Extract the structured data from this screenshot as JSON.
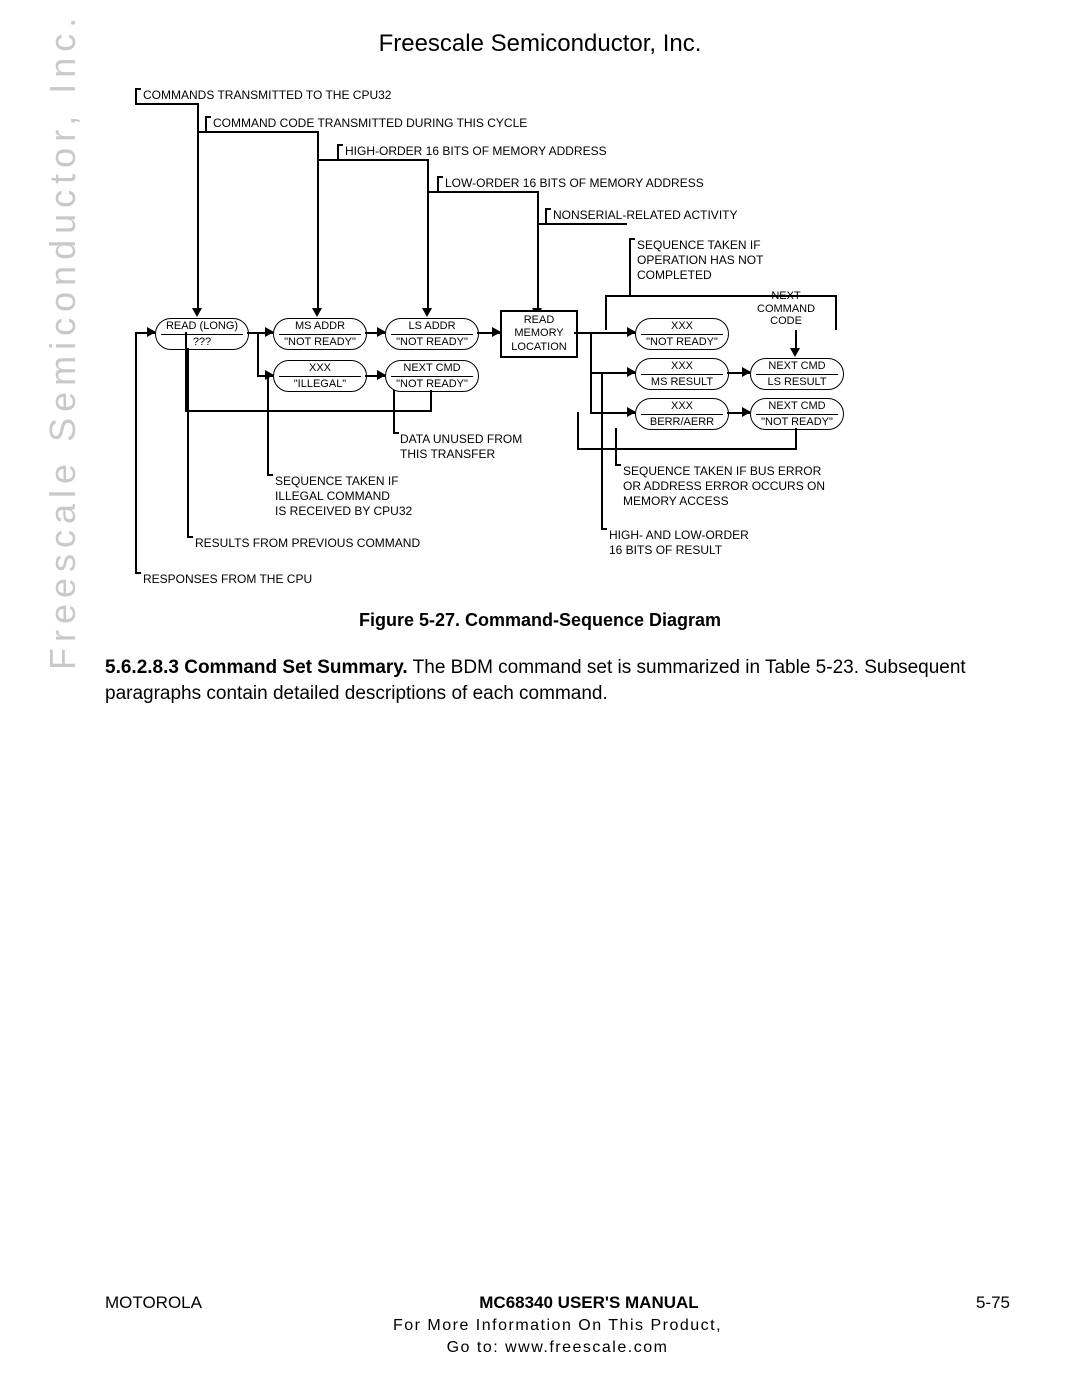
{
  "header": "Freescale Semiconductor, Inc.",
  "watermark": "Freescale Semiconductor, Inc.",
  "diagram": {
    "top_labels": {
      "l1": "COMMANDS TRANSMITTED TO THE CPU32",
      "l2": "COMMAND CODE TRANSMITTED DURING THIS CYCLE",
      "l3": "HIGH-ORDER 16 BITS OF MEMORY ADDRESS",
      "l4": "LOW-ORDER 16 BITS OF MEMORY ADDRESS",
      "l5": "NONSERIAL-RELATED ACTIVITY",
      "l6_a": "SEQUENCE TAKEN IF",
      "l6_b": "OPERATION HAS NOT",
      "l6_c": "COMPLETED"
    },
    "right_label": {
      "a": "NEXT",
      "b": "COMMAND",
      "c": "CODE"
    },
    "nodes": {
      "n1_top": "READ (LONG)",
      "n1_bot": "???",
      "n2_top": "MS ADDR",
      "n2_bot": "\"NOT READY\"",
      "n3_top": "LS ADDR",
      "n3_bot": "\"NOT READY\"",
      "rect_a": "READ",
      "rect_b": "MEMORY",
      "rect_c": "LOCATION",
      "n4_top": "XXX",
      "n4_bot": "\"NOT READY\"",
      "n5_top": "NEXT CMD",
      "n5_bot": "LS RESULT",
      "n6_top": "XXX",
      "n6_bot": "\"ILLEGAL\"",
      "n7_top": "NEXT CMD",
      "n7_bot": "\"NOT READY\"",
      "n8_top": "XXX",
      "n8_bot": "MS RESULT",
      "n9_top": "XXX",
      "n9_bot": "BERR/AERR",
      "n10_top": "NEXT CMD",
      "n10_bot": "\"NOT READY\""
    },
    "bottom_labels": {
      "b1_a": "DATA UNUSED FROM",
      "b1_b": "THIS TRANSFER",
      "b2_a": "SEQUENCE TAKEN IF",
      "b2_b": "ILLEGAL COMMAND",
      "b2_c": "IS RECEIVED BY CPU32",
      "b3": "RESULTS FROM PREVIOUS COMMAND",
      "b4": "RESPONSES FROM THE CPU",
      "b5_a": "SEQUENCE TAKEN IF BUS ERROR",
      "b5_b": "OR ADDRESS ERROR OCCURS ON",
      "b5_c": "MEMORY ACCESS",
      "b6_a": "HIGH- AND LOW-ORDER",
      "b6_b": "16 BITS OF RESULT"
    }
  },
  "figure_caption": "Figure 5-27. Command-Sequence Diagram",
  "body": {
    "lead": "5.6.2.8.3 Command Set Summary.",
    "rest": " The BDM command set is summarized in Table 5-23. Subsequent paragraphs contain detailed descriptions of each command."
  },
  "footer": {
    "left": "MOTOROLA",
    "center": "MC68340 USER'S MANUAL",
    "right": "5-75",
    "sub1": "For More Information On This Product,",
    "sub2": "Go to: www.freescale.com"
  }
}
